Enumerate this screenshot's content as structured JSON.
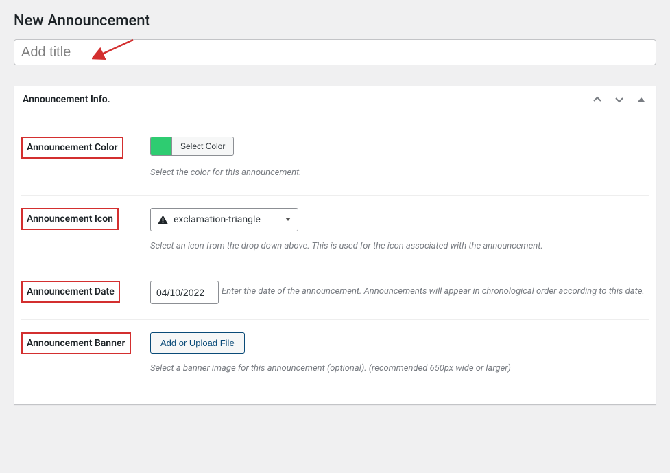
{
  "page": {
    "heading": "New Announcement",
    "title_placeholder": "Add title"
  },
  "metabox": {
    "title": "Announcement Info."
  },
  "fields": {
    "color": {
      "label": "Announcement Color",
      "button": "Select Color",
      "swatch_hex": "#2ecc71",
      "desc": "Select the color for this announcement."
    },
    "icon": {
      "label": "Announcement Icon",
      "selected": "exclamation-triangle",
      "desc": "Select an icon from the drop down above. This is used for the icon associated with the announcement."
    },
    "date": {
      "label": "Announcement Date",
      "value": "04/10/2022",
      "desc": "Enter the date of the announcement. Announcements will appear in chronological order according to this date."
    },
    "banner": {
      "label": "Announcement Banner",
      "button": "Add or Upload File",
      "desc": "Select a banner image for this announcement (optional). (recommended 650px wide or larger)"
    }
  }
}
